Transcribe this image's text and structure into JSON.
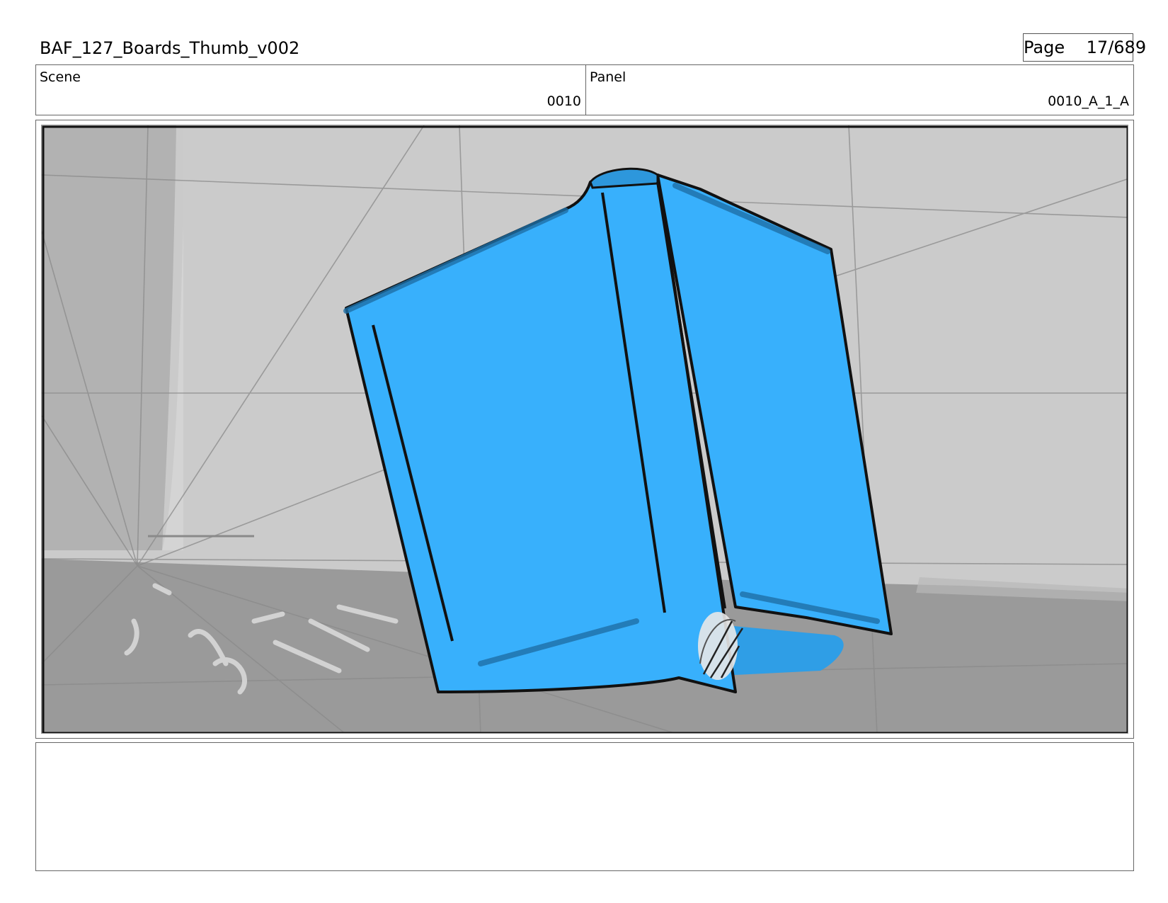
{
  "header": {
    "title": "BAF_127_Boards_Thumb_v002",
    "page_label": "Page",
    "page_value": "17/689"
  },
  "info": {
    "scene_label": "Scene",
    "scene_value": "0010",
    "panel_label": "Panel",
    "panel_value": "0010_A_1_A"
  },
  "frame": {
    "description_icon": "storyboard-drawing",
    "colors": {
      "book": "#38b0fc",
      "book_outline": "#111111",
      "wall": "#cbcbcb",
      "floor": "#9b9b9b",
      "pillar": "#b4b4b4"
    }
  },
  "notes": {
    "text": ""
  }
}
